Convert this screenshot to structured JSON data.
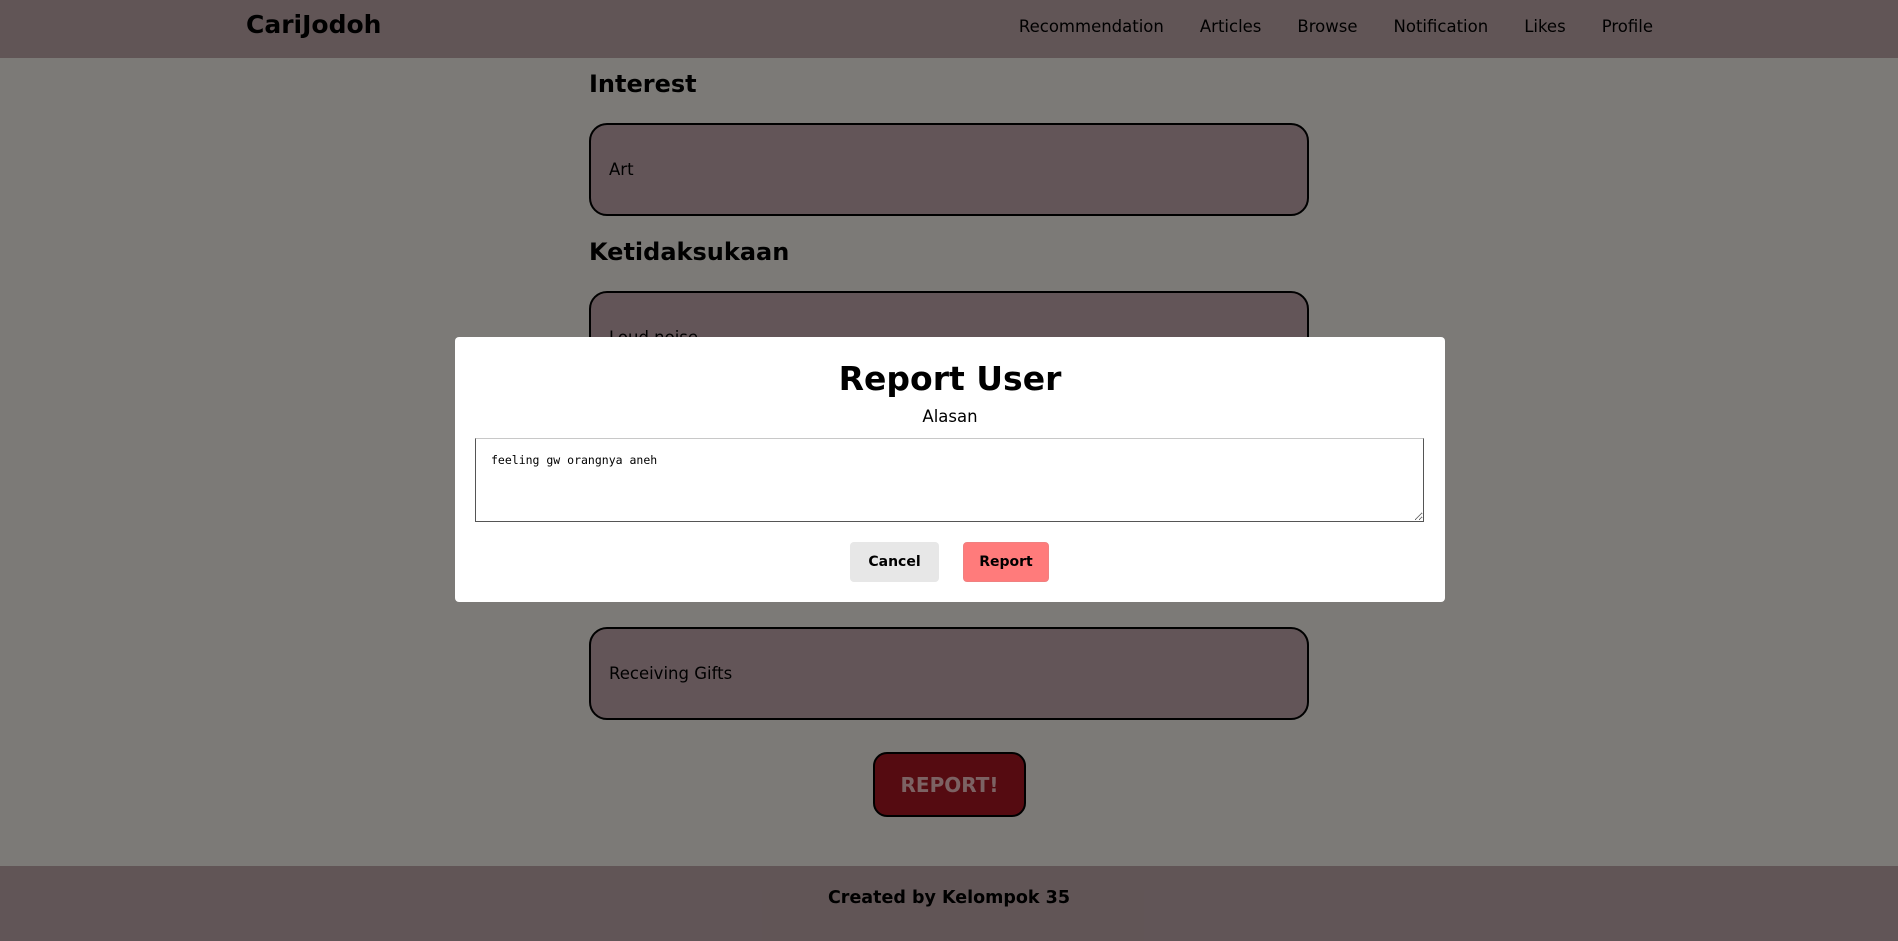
{
  "nav": {
    "brand": "CariJodoh",
    "links": [
      "Recommendation",
      "Articles",
      "Browse",
      "Notification",
      "Likes",
      "Profile"
    ]
  },
  "profile": {
    "interest_title": "Interest",
    "interest_value": "Art",
    "dislike_title": "Ketidaksukaan",
    "dislike_value": "Loud noise",
    "love_language_value": "Receiving Gifts",
    "report_button": "REPORT!"
  },
  "footer": {
    "text": "Created by Kelompok 35"
  },
  "modal": {
    "title": "Report User",
    "label": "Alasan",
    "reason_value": "feeling gw orangnya aneh",
    "cancel_label": "Cancel",
    "report_label": "Report"
  },
  "colors": {
    "navbar": "#bea7aa",
    "field": "#c2a8ac",
    "report_big": "#a81722",
    "report_btn": "#ff7b7b"
  }
}
